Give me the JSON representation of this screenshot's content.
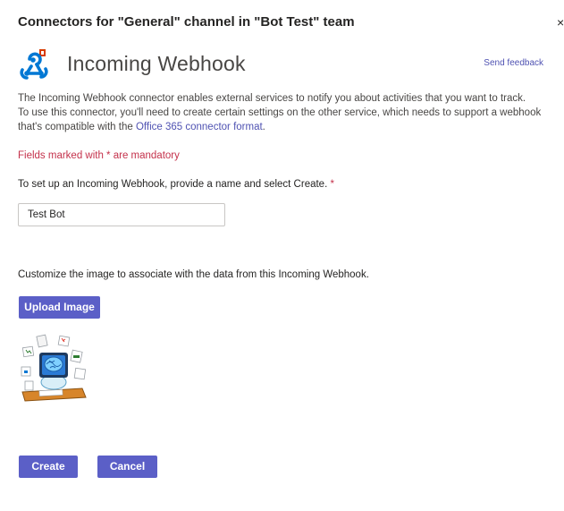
{
  "dialog": {
    "title": "Connectors for \"General\" channel in \"Bot Test\" team",
    "close_glyph": "×"
  },
  "connector": {
    "name": "Incoming Webhook",
    "logo_icon": "webhook-icon",
    "send_feedback_label": "Send feedback"
  },
  "description": {
    "line1": "The Incoming Webhook connector enables external services to notify you about activities that you want to track.",
    "line2": "To use this connector, you'll need to create certain settings on the other service, which needs to support a webhook that's compatible with the ",
    "link_text": "Office 365 connector format",
    "line2_end": "."
  },
  "form": {
    "mandatory_note": "Fields marked with * are mandatory",
    "name_prompt": "To set up an Incoming Webhook, provide a name and select Create.",
    "required_marker": "*",
    "name_value": "Test Bot",
    "image_prompt": "Customize the image to associate with the data from this Incoming Webhook.",
    "upload_label": "Upload Image",
    "bot_image_icon": "bot-avatar-image"
  },
  "actions": {
    "create_label": "Create",
    "cancel_label": "Cancel"
  },
  "colors": {
    "accent": "#5b5fc7",
    "link": "#4f52b2",
    "required": "#c4314b"
  }
}
